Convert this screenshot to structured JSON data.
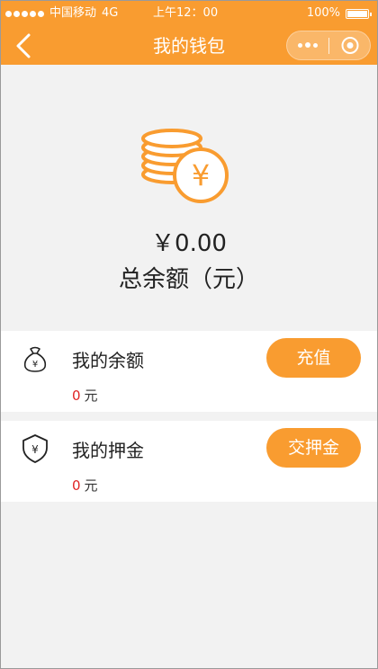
{
  "status_bar": {
    "carrier": "中国移动",
    "network": "4G",
    "time": "上午12：00",
    "battery": "100%"
  },
  "nav": {
    "title": "我的钱包"
  },
  "balance": {
    "amount": "￥0.00",
    "label": "总余额（元）"
  },
  "cards": [
    {
      "title": "我的余额",
      "value": "0",
      "unit": "元",
      "button": "充值",
      "icon": "money-bag-icon"
    },
    {
      "title": "我的押金",
      "value": "0",
      "unit": "元",
      "button": "交押金",
      "icon": "shield-yen-icon"
    }
  ],
  "colors": {
    "accent": "#f99c30",
    "value_red": "#e02424",
    "background": "#f2f2f2"
  }
}
